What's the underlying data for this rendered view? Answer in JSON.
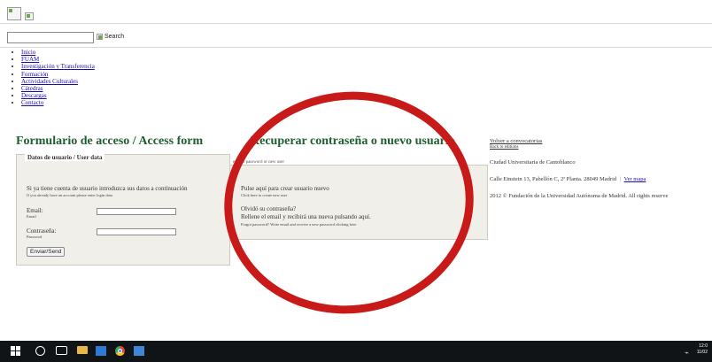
{
  "header": {
    "search_button_label": "Search"
  },
  "nav": {
    "items": [
      "Inicio",
      "FUAM",
      "Investigación y Transferencia",
      "Formación",
      "Actividades Culturales",
      "Cátedras",
      "Descargas",
      "Contacto"
    ]
  },
  "access_form": {
    "title": "Formulario de acceso / Access form",
    "legend": "Datos de usuario / User data",
    "intro_es": "Si ya tiene cuenta de usuario introduzca sus datos a continuación",
    "intro_en": "If you already have an account please enter login data",
    "email_label": "Email:",
    "email_sub": "Email",
    "password_label": "Contraseña:",
    "password_sub": "Password",
    "email_value": "",
    "password_value": "",
    "submit_label": "Enviar/Send"
  },
  "recover": {
    "title": "Recuperar contraseña o nuevo usuario",
    "legend": "ecover password or new user",
    "create_es": "Pulse aquí para crear usuario nuevo",
    "create_en": "Click here to create new user",
    "forgot_q": "Olvidó su contraseña?",
    "forgot_es": "Rellene el email y recibirá una nueva pulsando aquí.",
    "forgot_en": "Forgot password? Write email and receive a new password clicking here"
  },
  "sidebar": {
    "back_calls": "Volver a convocatorias",
    "back_editions": "Back to editions",
    "campus": "Ciudad Universitaria de Cantoblanco",
    "address": "Calle Einstein 13, Pabellón C, 2ª Planta. 28049 Madrid",
    "separator": "|",
    "map_link": "Ver mapa",
    "copyright": "2012 © Fundación de la Universidad Autónoma de Madrid. All rights reserve"
  },
  "taskbar": {
    "time": "12:0",
    "date": "11/02"
  },
  "colors": {
    "annotation": "#c91a1a",
    "heading_green": "#1e5e2e",
    "panel_bg": "#f1efe9"
  }
}
